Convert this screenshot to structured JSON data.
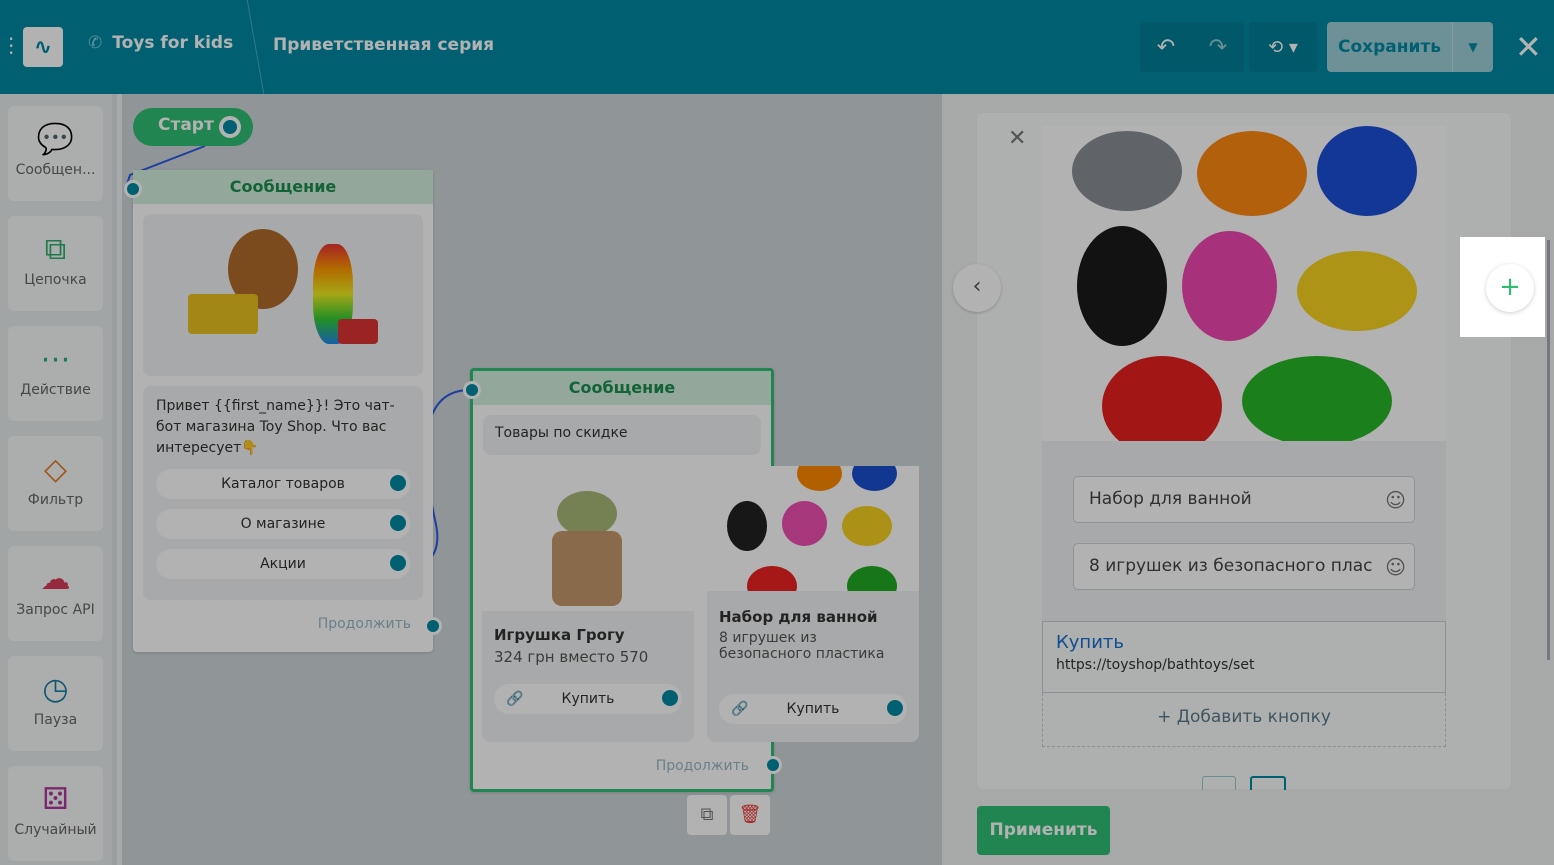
{
  "header": {
    "brand": "Toys for kids",
    "flow_title": "Приветственная серия",
    "save_label": "Сохранить"
  },
  "sidebar": {
    "items": [
      {
        "label": "Сообщен..."
      },
      {
        "label": "Цепочка"
      },
      {
        "label": "Действие"
      },
      {
        "label": "Фильтр"
      },
      {
        "label": "Запрос API"
      },
      {
        "label": "Пауза"
      },
      {
        "label": "Случайный"
      }
    ]
  },
  "canvas": {
    "start_label": "Старт",
    "node1": {
      "title": "Сообщение",
      "text": "Привет {{first_name}}! Это чат-бот магазина Toy Shop. Что вас интересует👇",
      "buttons": [
        "Каталог товаров",
        "О магазине",
        "Акции"
      ],
      "continue": "Продолжить"
    },
    "node2": {
      "title": "Сообщение",
      "text": "Товары по скидке",
      "cards": [
        {
          "title": "Игрушка Грогу",
          "subtitle": "324 грн вместо 570",
          "button": "Купить"
        },
        {
          "title": "Набор для ванной",
          "subtitle": "8 игрушек из безопасного пластика",
          "button": "Купить"
        }
      ],
      "continue": "Продолжить"
    }
  },
  "panel": {
    "title_value": "Набор для ванной",
    "subtitle_value": "8 игрушек из безопасного плас",
    "button_label": "Купить",
    "button_url": "https://toyshop/bathtoys/set",
    "add_button": "+ Добавить кнопку",
    "apply": "Применить"
  }
}
